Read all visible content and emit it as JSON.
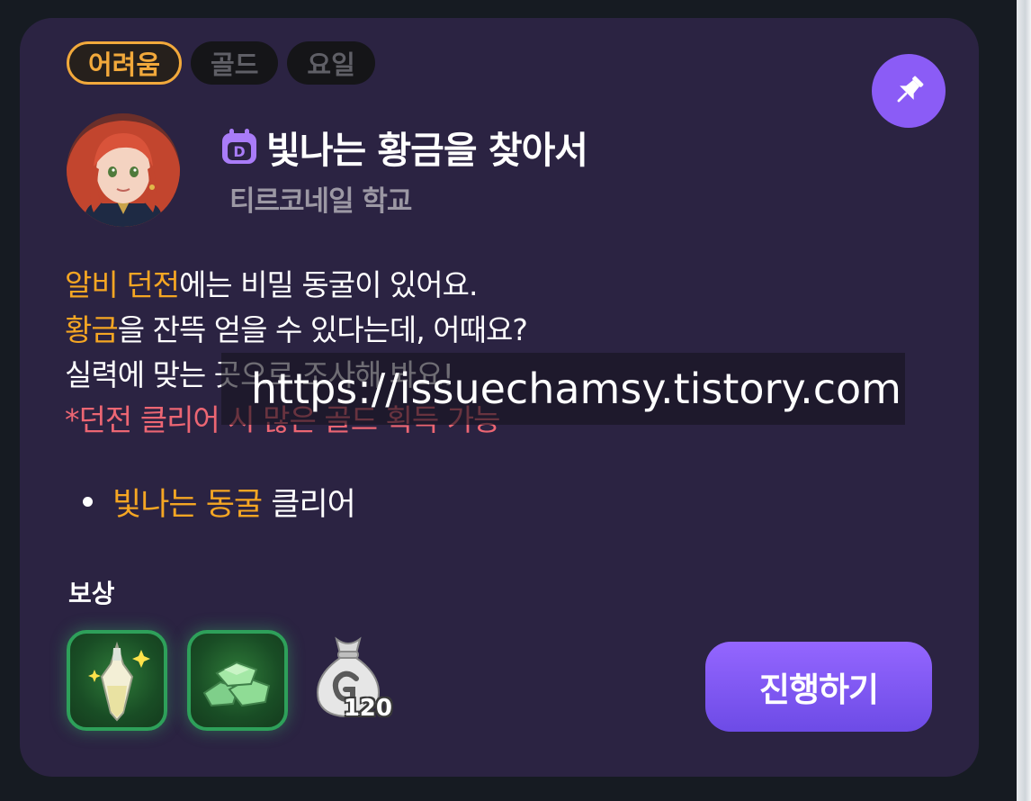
{
  "tags": {
    "difficulty": "어려움",
    "reward_type": "골드",
    "schedule": "요일"
  },
  "quest": {
    "title": "빛나는 황금을 찾아서",
    "giver": "티르코네일 학교",
    "title_icon_letter": "D"
  },
  "description": {
    "line1_highlight": "알비 던전",
    "line1_rest": "에는 비밀 동굴이 있어요.",
    "line2_highlight": "황금",
    "line2_rest": "을 잔뜩 얻을 수 있다는데, 어때요?",
    "line3": "실력에 맞는 곳으로 조사해 봐요!",
    "note": "*던전 클리어 시 많은 골드 획득 가능"
  },
  "objective": {
    "highlight": "빛나는 동굴",
    "rest": " 클리어"
  },
  "rewards": {
    "label": "보상",
    "items": [
      {
        "icon": "elixir-bottle-icon"
      },
      {
        "icon": "ore-pile-icon"
      },
      {
        "icon": "gold-bag-icon",
        "count": "120"
      }
    ]
  },
  "action": {
    "proceed_label": "진행하기"
  },
  "watermark": "https://issuechamsy.tistory.com",
  "colors": {
    "accent_orange": "#f5a623",
    "note_red": "#ec6673",
    "button_purple": "#8b5cf6",
    "card_bg": "#2b2342"
  }
}
